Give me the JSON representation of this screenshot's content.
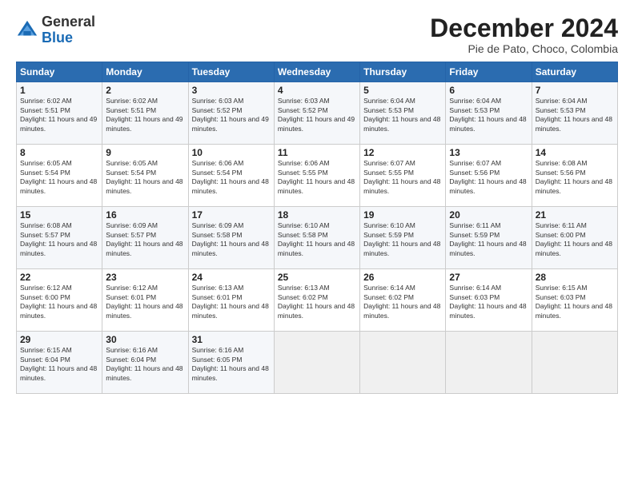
{
  "header": {
    "logo_general": "General",
    "logo_blue": "Blue",
    "month_title": "December 2024",
    "location": "Pie de Pato, Choco, Colombia"
  },
  "weekdays": [
    "Sunday",
    "Monday",
    "Tuesday",
    "Wednesday",
    "Thursday",
    "Friday",
    "Saturday"
  ],
  "weeks": [
    [
      {
        "day": "1",
        "sunrise": "6:02 AM",
        "sunset": "5:51 PM",
        "daylight": "11 hours and 49 minutes."
      },
      {
        "day": "2",
        "sunrise": "6:02 AM",
        "sunset": "5:51 PM",
        "daylight": "11 hours and 49 minutes."
      },
      {
        "day": "3",
        "sunrise": "6:03 AM",
        "sunset": "5:52 PM",
        "daylight": "11 hours and 49 minutes."
      },
      {
        "day": "4",
        "sunrise": "6:03 AM",
        "sunset": "5:52 PM",
        "daylight": "11 hours and 49 minutes."
      },
      {
        "day": "5",
        "sunrise": "6:04 AM",
        "sunset": "5:53 PM",
        "daylight": "11 hours and 48 minutes."
      },
      {
        "day": "6",
        "sunrise": "6:04 AM",
        "sunset": "5:53 PM",
        "daylight": "11 hours and 48 minutes."
      },
      {
        "day": "7",
        "sunrise": "6:04 AM",
        "sunset": "5:53 PM",
        "daylight": "11 hours and 48 minutes."
      }
    ],
    [
      {
        "day": "8",
        "sunrise": "6:05 AM",
        "sunset": "5:54 PM",
        "daylight": "11 hours and 48 minutes."
      },
      {
        "day": "9",
        "sunrise": "6:05 AM",
        "sunset": "5:54 PM",
        "daylight": "11 hours and 48 minutes."
      },
      {
        "day": "10",
        "sunrise": "6:06 AM",
        "sunset": "5:54 PM",
        "daylight": "11 hours and 48 minutes."
      },
      {
        "day": "11",
        "sunrise": "6:06 AM",
        "sunset": "5:55 PM",
        "daylight": "11 hours and 48 minutes."
      },
      {
        "day": "12",
        "sunrise": "6:07 AM",
        "sunset": "5:55 PM",
        "daylight": "11 hours and 48 minutes."
      },
      {
        "day": "13",
        "sunrise": "6:07 AM",
        "sunset": "5:56 PM",
        "daylight": "11 hours and 48 minutes."
      },
      {
        "day": "14",
        "sunrise": "6:08 AM",
        "sunset": "5:56 PM",
        "daylight": "11 hours and 48 minutes."
      }
    ],
    [
      {
        "day": "15",
        "sunrise": "6:08 AM",
        "sunset": "5:57 PM",
        "daylight": "11 hours and 48 minutes."
      },
      {
        "day": "16",
        "sunrise": "6:09 AM",
        "sunset": "5:57 PM",
        "daylight": "11 hours and 48 minutes."
      },
      {
        "day": "17",
        "sunrise": "6:09 AM",
        "sunset": "5:58 PM",
        "daylight": "11 hours and 48 minutes."
      },
      {
        "day": "18",
        "sunrise": "6:10 AM",
        "sunset": "5:58 PM",
        "daylight": "11 hours and 48 minutes."
      },
      {
        "day": "19",
        "sunrise": "6:10 AM",
        "sunset": "5:59 PM",
        "daylight": "11 hours and 48 minutes."
      },
      {
        "day": "20",
        "sunrise": "6:11 AM",
        "sunset": "5:59 PM",
        "daylight": "11 hours and 48 minutes."
      },
      {
        "day": "21",
        "sunrise": "6:11 AM",
        "sunset": "6:00 PM",
        "daylight": "11 hours and 48 minutes."
      }
    ],
    [
      {
        "day": "22",
        "sunrise": "6:12 AM",
        "sunset": "6:00 PM",
        "daylight": "11 hours and 48 minutes."
      },
      {
        "day": "23",
        "sunrise": "6:12 AM",
        "sunset": "6:01 PM",
        "daylight": "11 hours and 48 minutes."
      },
      {
        "day": "24",
        "sunrise": "6:13 AM",
        "sunset": "6:01 PM",
        "daylight": "11 hours and 48 minutes."
      },
      {
        "day": "25",
        "sunrise": "6:13 AM",
        "sunset": "6:02 PM",
        "daylight": "11 hours and 48 minutes."
      },
      {
        "day": "26",
        "sunrise": "6:14 AM",
        "sunset": "6:02 PM",
        "daylight": "11 hours and 48 minutes."
      },
      {
        "day": "27",
        "sunrise": "6:14 AM",
        "sunset": "6:03 PM",
        "daylight": "11 hours and 48 minutes."
      },
      {
        "day": "28",
        "sunrise": "6:15 AM",
        "sunset": "6:03 PM",
        "daylight": "11 hours and 48 minutes."
      }
    ],
    [
      {
        "day": "29",
        "sunrise": "6:15 AM",
        "sunset": "6:04 PM",
        "daylight": "11 hours and 48 minutes."
      },
      {
        "day": "30",
        "sunrise": "6:16 AM",
        "sunset": "6:04 PM",
        "daylight": "11 hours and 48 minutes."
      },
      {
        "day": "31",
        "sunrise": "6:16 AM",
        "sunset": "6:05 PM",
        "daylight": "11 hours and 48 minutes."
      },
      null,
      null,
      null,
      null
    ]
  ]
}
